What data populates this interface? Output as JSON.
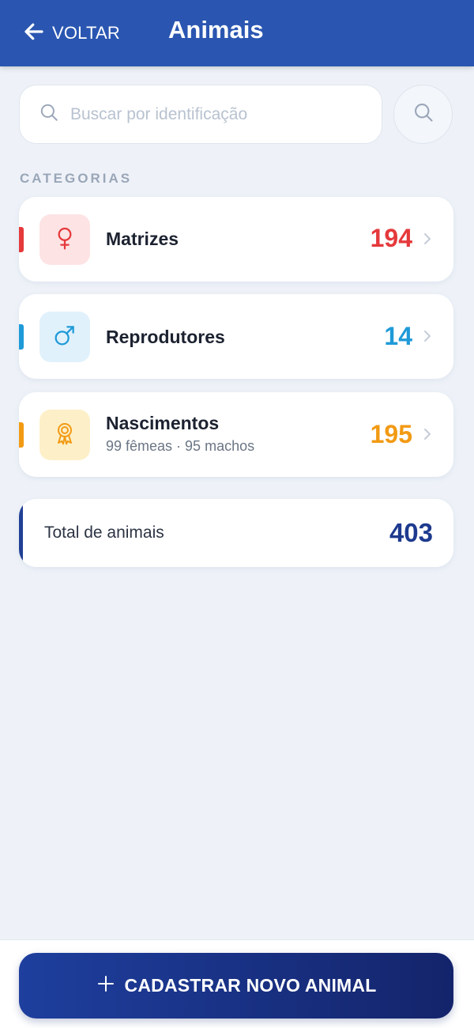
{
  "header": {
    "back_label": "VOLTAR",
    "title": "Animais",
    "background_color": "#2a56b1"
  },
  "search": {
    "placeholder": "Buscar por identificação",
    "value": ""
  },
  "categories_label": "CATEGORIAS",
  "categories": [
    {
      "label": "Matrizes",
      "sublabel": "",
      "count": "194",
      "icon": "female-symbol-icon",
      "color": "#e5393c",
      "tile_color": "#fde3e4"
    },
    {
      "label": "Reprodutores",
      "sublabel": "",
      "count": "14",
      "icon": "male-symbol-icon",
      "color": "#1f9ad8",
      "tile_color": "#e0f1fc"
    },
    {
      "label": "Nascimentos",
      "sublabel": "99 fêmeas · 95 machos",
      "count": "195",
      "icon": "award-ribbon-icon",
      "color": "#f29a14",
      "tile_color": "#fdf0c8"
    }
  ],
  "total": {
    "label": "Total de animais",
    "value": "403",
    "color": "#1d3a8f"
  },
  "footer": {
    "cta_label": "CADASTRAR NOVO ANIMAL",
    "cta_icon": "plus-icon"
  }
}
